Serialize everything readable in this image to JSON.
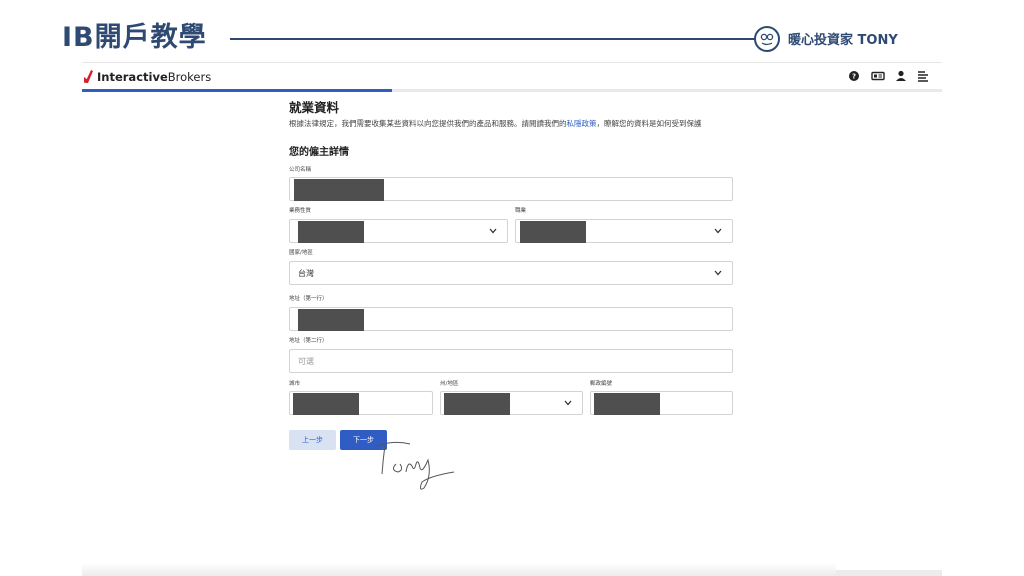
{
  "slide": {
    "title": "IB開戶教學",
    "brand": "暖心投資家 TONY"
  },
  "app": {
    "logo_bold": "Interactive",
    "logo_rest": "Brokers",
    "progress": 0.36
  },
  "form": {
    "title": "就業資料",
    "intro_before": "根據法律規定，我們需要收集某些資料以向您提供我們的產品和服務。請閱讀我們的",
    "privacy_link": "私隱政策",
    "intro_after": "，瞭解您的資料是如何受到保護",
    "employer_heading": "您的僱主詳情",
    "fields": {
      "company": {
        "label": "公司名稱",
        "value": ""
      },
      "business": {
        "label": "業務性質",
        "value": ""
      },
      "occupation": {
        "label": "職業",
        "value": ""
      },
      "country": {
        "label": "國家/地區",
        "value": "台灣"
      },
      "address1": {
        "label": "地址（第一行）",
        "value": ""
      },
      "address2": {
        "label": "地址（第二行）",
        "placeholder": "可選"
      },
      "city": {
        "label": "城市",
        "value": ""
      },
      "state": {
        "label": "州/地區",
        "value": ""
      },
      "postal": {
        "label": "郵政編號",
        "value": ""
      }
    },
    "buttons": {
      "back": "上一步",
      "next": "下一步"
    }
  },
  "colors": {
    "accent": "#2f5dc4",
    "slide_title": "#2e4a73",
    "ib_red": "#d81e2c",
    "redaction": "#4f4f4f"
  },
  "icons": [
    "help-icon",
    "id-card-icon",
    "user-icon",
    "menu-icon",
    "chevron-down-icon"
  ]
}
